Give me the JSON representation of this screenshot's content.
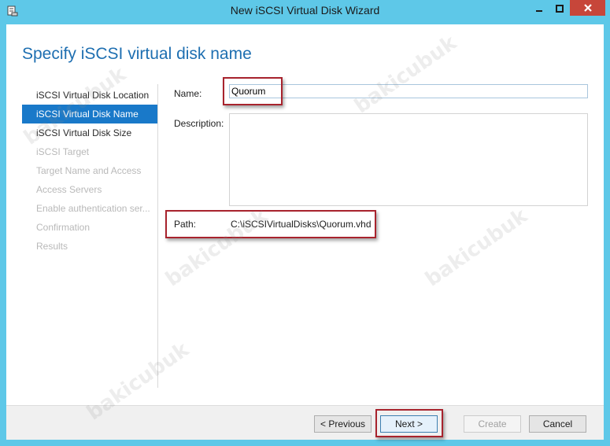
{
  "window": {
    "title": "New iSCSI Virtual Disk Wizard"
  },
  "page": {
    "title": "Specify iSCSI virtual disk name"
  },
  "nav": {
    "items": [
      {
        "label": "iSCSI Virtual Disk Location",
        "state": "normal"
      },
      {
        "label": "iSCSI Virtual Disk Name",
        "state": "active"
      },
      {
        "label": "iSCSI Virtual Disk Size",
        "state": "normal"
      },
      {
        "label": "iSCSI Target",
        "state": "disabled"
      },
      {
        "label": "Target Name and Access",
        "state": "disabled"
      },
      {
        "label": "Access Servers",
        "state": "disabled"
      },
      {
        "label": "Enable authentication ser...",
        "state": "disabled"
      },
      {
        "label": "Confirmation",
        "state": "disabled"
      },
      {
        "label": "Results",
        "state": "disabled"
      }
    ]
  },
  "form": {
    "name_label": "Name:",
    "name_value": "Quorum",
    "description_label": "Description:",
    "description_value": "",
    "path_label": "Path:",
    "path_value": "C:\\iSCSIVirtualDisks\\Quorum.vhd"
  },
  "buttons": {
    "previous": "< Previous",
    "next": "Next >",
    "create": "Create",
    "cancel": "Cancel"
  },
  "watermark": "bakicubuk",
  "colors": {
    "frame": "#5ec8e8",
    "accent": "#1e6fb1",
    "nav_active": "#1979c9",
    "highlight": "#a8232d",
    "close": "#c7463a"
  },
  "icons": {
    "app": "server-icon",
    "minimize": "minimize-icon",
    "maximize": "maximize-icon",
    "close": "close-icon"
  }
}
